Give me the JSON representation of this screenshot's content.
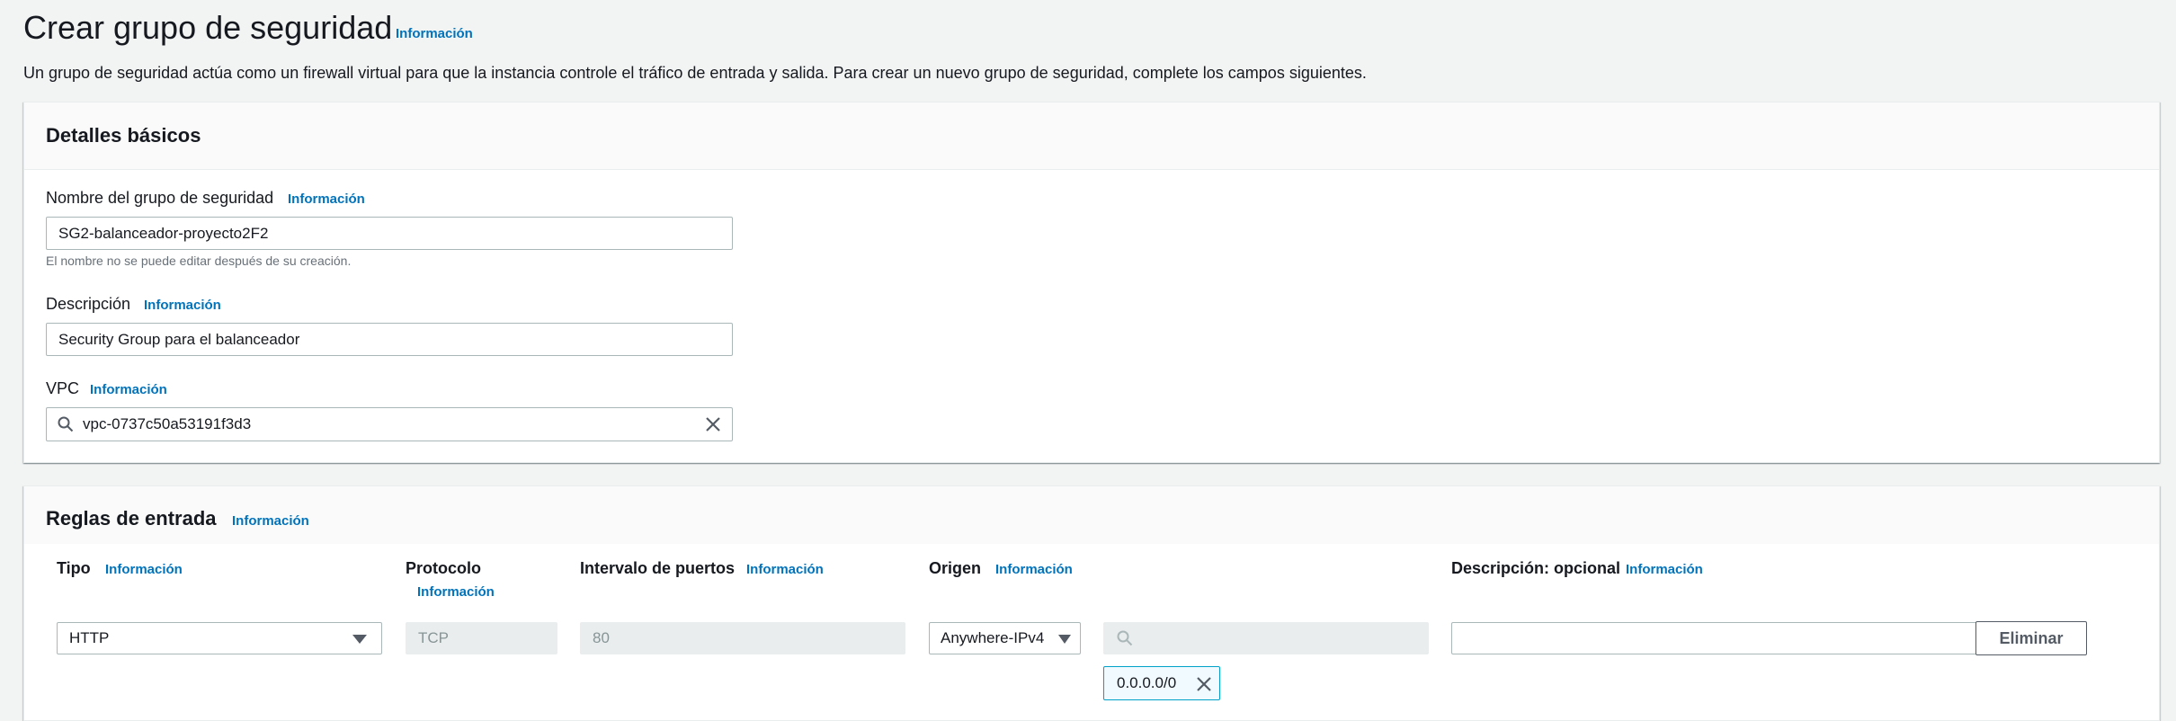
{
  "page": {
    "title": "Crear grupo de seguridad",
    "info_link": "Información",
    "description": "Un grupo de seguridad actúa como un firewall virtual para que la instancia controle el tráfico de entrada y salida. Para crear un nuevo grupo de seguridad, complete los campos siguientes."
  },
  "basic_details": {
    "title": "Detalles básicos",
    "name_label": "Nombre del grupo de seguridad",
    "name_info": "Información",
    "name_value": "SG2-balanceador-proyecto2F2",
    "name_hint": "El nombre no se puede editar después de su creación.",
    "desc_label": "Descripción",
    "desc_info": "Información",
    "desc_value": "Security Group para el balanceador",
    "vpc_label": "VPC",
    "vpc_info": "Información",
    "vpc_value": "vpc-0737c50a53191f3d3",
    "vpc_icon": "search-icon",
    "vpc_clear_icon": "close-icon"
  },
  "inbound_rules": {
    "title": "Reglas de entrada",
    "info": "Información",
    "columns": {
      "type": "Tipo",
      "type_info": "Información",
      "protocol": "Protocolo",
      "protocol_info": "Información",
      "port_range": "Intervalo de puertos",
      "port_range_info": "Información",
      "source": "Origen",
      "source_info": "Información",
      "description": "Descripción: opcional",
      "description_info": "Información"
    },
    "rows": [
      {
        "type": "HTTP",
        "protocol": "TCP",
        "port_range": "80",
        "source_type": "Anywhere-IPv4",
        "source_search": "",
        "description": "",
        "delete_label": "Eliminar",
        "source_token": "0.0.0.0/0"
      }
    ]
  },
  "colors": {
    "link": "#0073bb",
    "background": "#f2f3f3",
    "token_border": "#00a1c9"
  }
}
